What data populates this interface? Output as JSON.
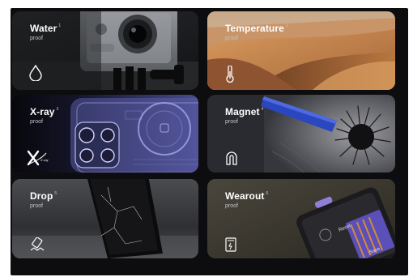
{
  "cards": [
    {
      "title": "Water",
      "num": "1",
      "sub": "proof",
      "icon": "water-drop-icon"
    },
    {
      "title": "Temperature",
      "num": "2",
      "sub": "proof",
      "icon": "thermometer-icon"
    },
    {
      "title": "X-ray",
      "num": "3",
      "sub": "proof",
      "icon": "x-ray-icon"
    },
    {
      "title": "Magnet",
      "num": "4",
      "sub": "proof",
      "icon": "magnet-icon"
    },
    {
      "title": "Drop",
      "num": "5",
      "sub": "proof",
      "icon": "drop-test-icon"
    },
    {
      "title": "Wearout",
      "num": "6",
      "sub": "proof",
      "icon": "wearout-icon"
    }
  ],
  "xray_logo_text": "X-ray",
  "wearout_phone": {
    "reset_label": "Reset",
    "save_label": "Save"
  },
  "colors": {
    "frame_bg": "#0d0d0f",
    "xray_accent": "#4d4f9c",
    "magnet_accent": "#2d47b8",
    "phone_accent": "#8f7fd6"
  }
}
